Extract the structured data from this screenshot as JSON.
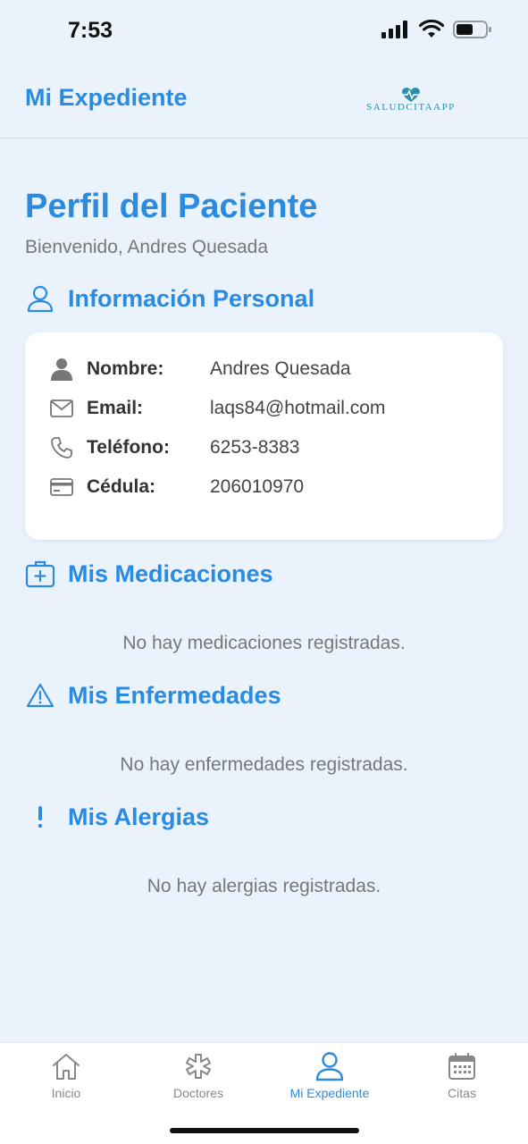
{
  "status_bar": {
    "time": "7:53"
  },
  "header": {
    "title": "Mi Expediente",
    "brand": "SALUDCITAAPP"
  },
  "page": {
    "title": "Perfil del Paciente",
    "subtitle": "Bienvenido, Andres Quesada"
  },
  "personal_info": {
    "title": "Información Personal",
    "rows": [
      {
        "icon": "person-icon",
        "label": "Nombre:",
        "value": "Andres Quesada"
      },
      {
        "icon": "mail-icon",
        "label": "Email:",
        "value": "laqs84@hotmail.com"
      },
      {
        "icon": "phone-icon",
        "label": "Teléfono:",
        "value": "6253-8383"
      },
      {
        "icon": "card-icon",
        "label": "Cédula:",
        "value": "206010970"
      }
    ]
  },
  "medications": {
    "title": "Mis Medicaciones",
    "empty": "No hay medicaciones registradas."
  },
  "diseases": {
    "title": "Mis Enfermedades",
    "empty": "No hay enfermedades registradas."
  },
  "allergies": {
    "title": "Mis Alergias",
    "empty": "No hay alergias registradas."
  },
  "tabs": [
    {
      "label": "Inicio",
      "icon": "home-icon",
      "active": false
    },
    {
      "label": "Doctores",
      "icon": "medical-star-icon",
      "active": false
    },
    {
      "label": "Mi Expediente",
      "icon": "person-icon",
      "active": true
    },
    {
      "label": "Citas",
      "icon": "calendar-icon",
      "active": false
    }
  ],
  "colors": {
    "accent": "#2a8be0",
    "background": "#eaf3fc",
    "muted": "#777777"
  }
}
